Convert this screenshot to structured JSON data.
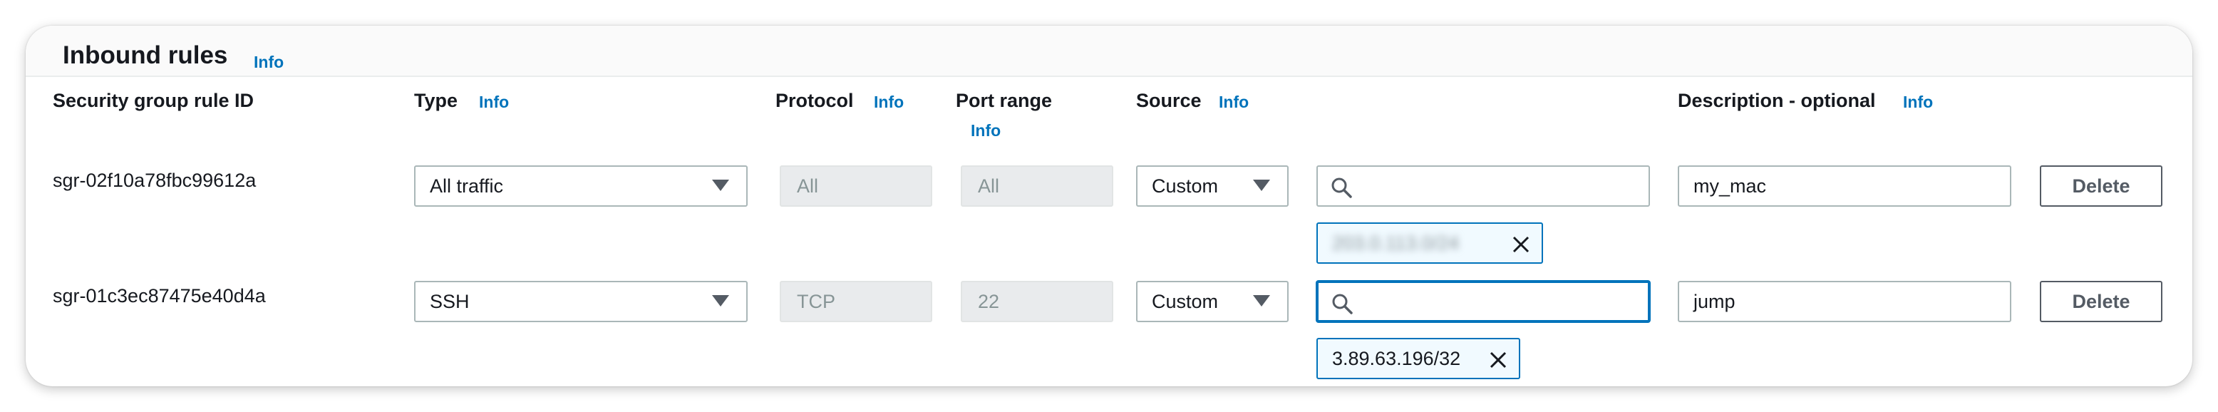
{
  "section": {
    "title": "Inbound rules",
    "info_label": "Info"
  },
  "columns": {
    "rule_id": "Security group rule ID",
    "type": "Type",
    "protocol": "Protocol",
    "port_range": "Port range",
    "source": "Source",
    "description": "Description - optional",
    "info_label": "Info"
  },
  "rules": [
    {
      "rule_id": "sgr-02f10a78fbc99612a",
      "type": "All traffic",
      "protocol": "All",
      "port_range": "All",
      "source_type": "Custom",
      "source_search_value": "",
      "source_token": "203.0.113.0/24",
      "source_token_blurred": true,
      "description": "my_mac",
      "delete_label": "Delete"
    },
    {
      "rule_id": "sgr-01c3ec87475e40d4a",
      "type": "SSH",
      "protocol": "TCP",
      "port_range": "22",
      "source_type": "Custom",
      "source_search_value": "",
      "source_token": "3.89.63.196/32",
      "source_token_blurred": false,
      "description": "jump",
      "delete_label": "Delete"
    }
  ],
  "icons": {
    "search": "search-icon",
    "dropdown": "caret-down-icon",
    "remove": "close-icon"
  },
  "colors": {
    "link": "#0073bb",
    "text": "#16191f",
    "border": "#aab7b8",
    "readonly_bg": "#e9ebed",
    "token_bg": "#f1faff"
  }
}
